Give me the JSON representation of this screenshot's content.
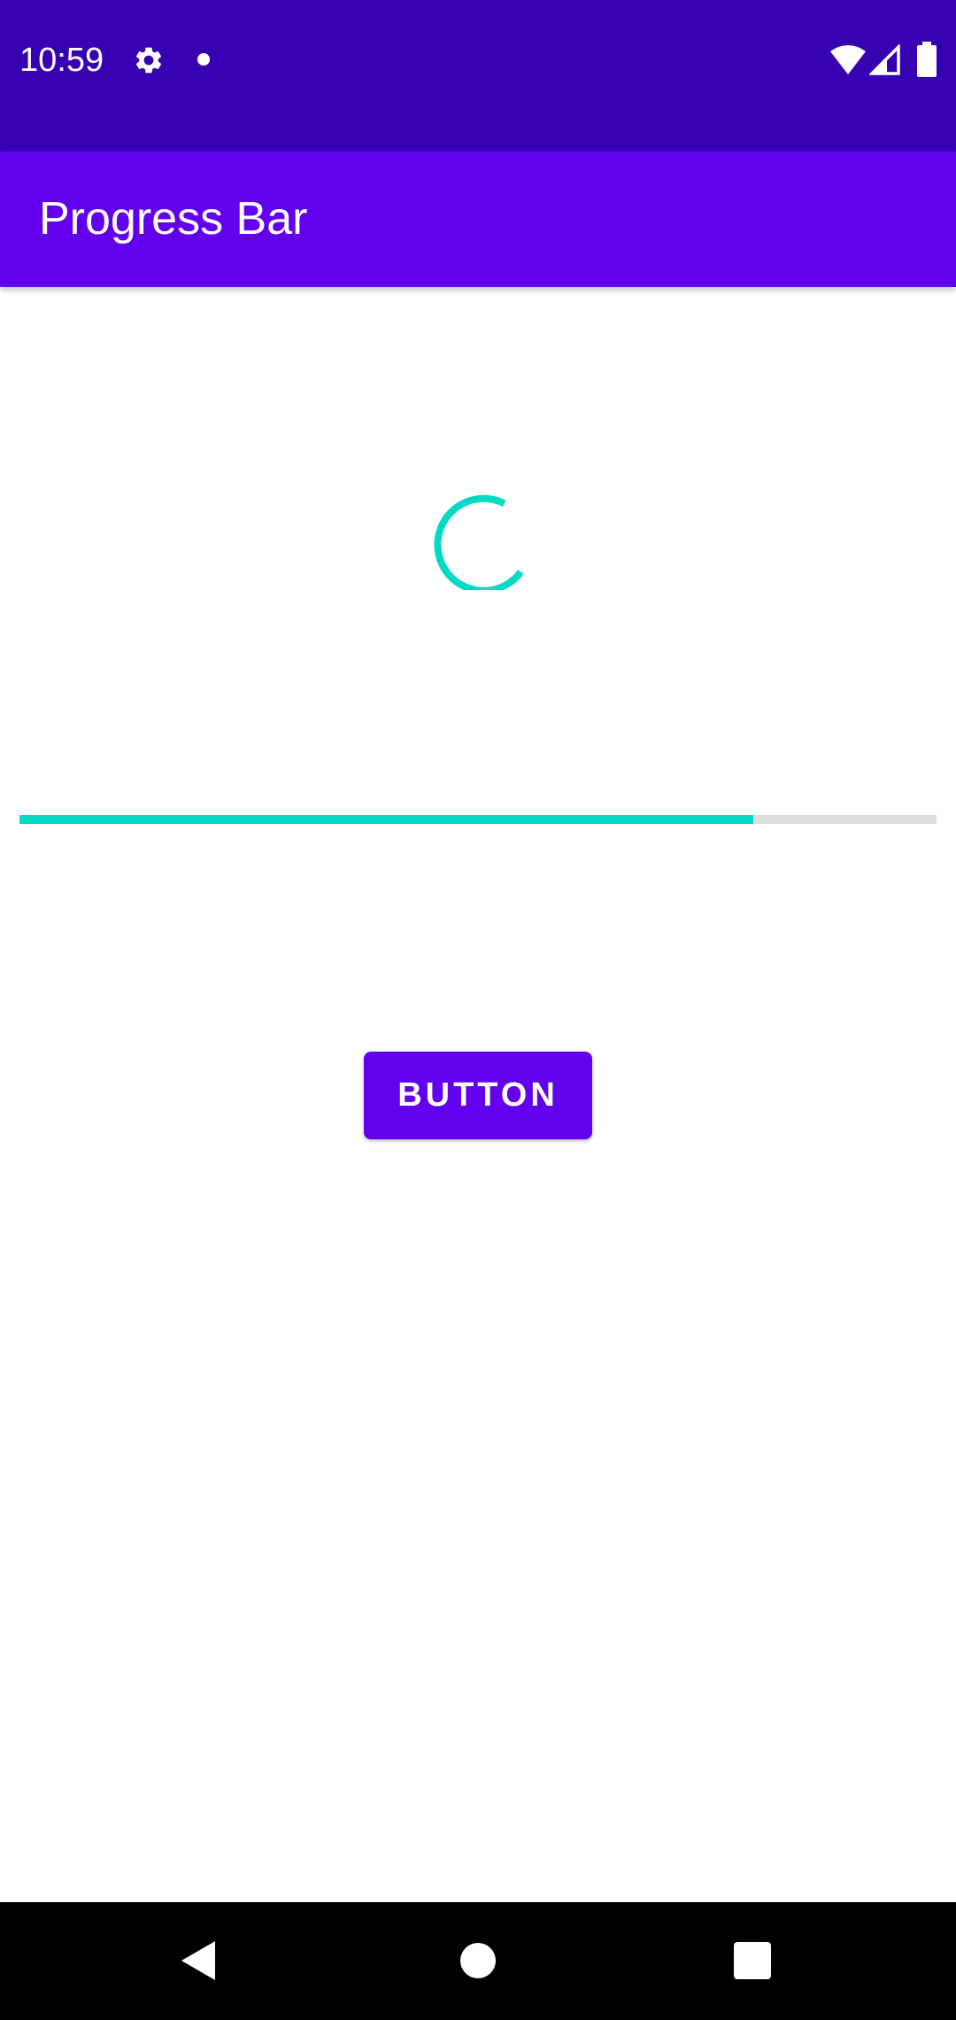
{
  "status_bar": {
    "time": "10:59",
    "icons": [
      "gear-icon",
      "notification-dot-icon",
      "wifi-icon",
      "cell-signal-icon",
      "battery-icon"
    ],
    "background_color": "#3700b3"
  },
  "app_bar": {
    "title": "Progress Bar",
    "background_color": "#6200ee"
  },
  "main": {
    "spinner": {
      "state": "indeterminate",
      "color": "#03dac5"
    },
    "progress_bar": {
      "progress": 0.8,
      "fill_color": "#03dac5",
      "track_color": "#dddddd"
    },
    "button": {
      "label": "BUTTON",
      "color": "#6200ee"
    }
  },
  "nav_bar": {
    "icons": [
      "back-icon",
      "home-icon",
      "recents-icon"
    ]
  }
}
